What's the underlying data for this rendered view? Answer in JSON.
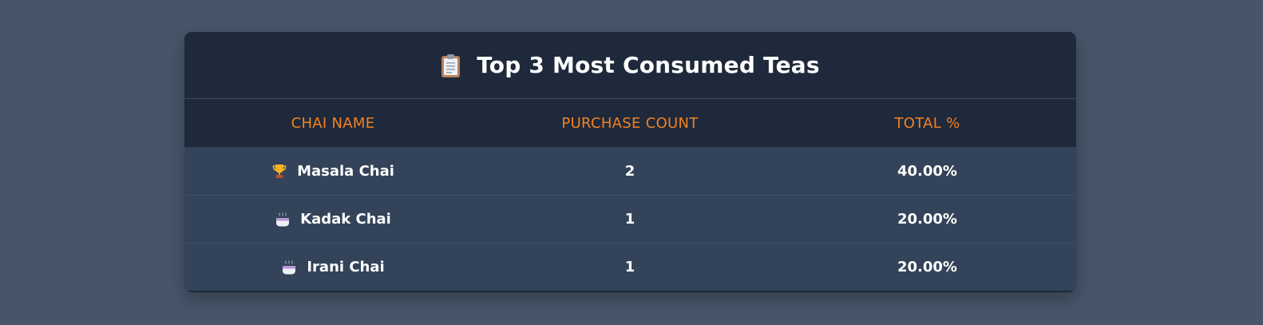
{
  "title": "Top 3 Most Consumed Teas",
  "title_icon": "clipboard-icon",
  "columns": [
    "CHAI NAME",
    "PURCHASE COUNT",
    "TOTAL %"
  ],
  "rows": [
    {
      "icon": "trophy-icon",
      "name": "Masala Chai",
      "count": "2",
      "percent": "40.00%"
    },
    {
      "icon": "tea-cup-icon",
      "name": "Kadak Chai",
      "count": "1",
      "percent": "20.00%"
    },
    {
      "icon": "tea-cup-icon",
      "name": "Irani Chai",
      "count": "1",
      "percent": "20.00%"
    }
  ],
  "colors": {
    "background": "#475569",
    "card": "#1e293b",
    "row": "#334359",
    "header_text": "#f48120",
    "text": "#ffffff"
  }
}
